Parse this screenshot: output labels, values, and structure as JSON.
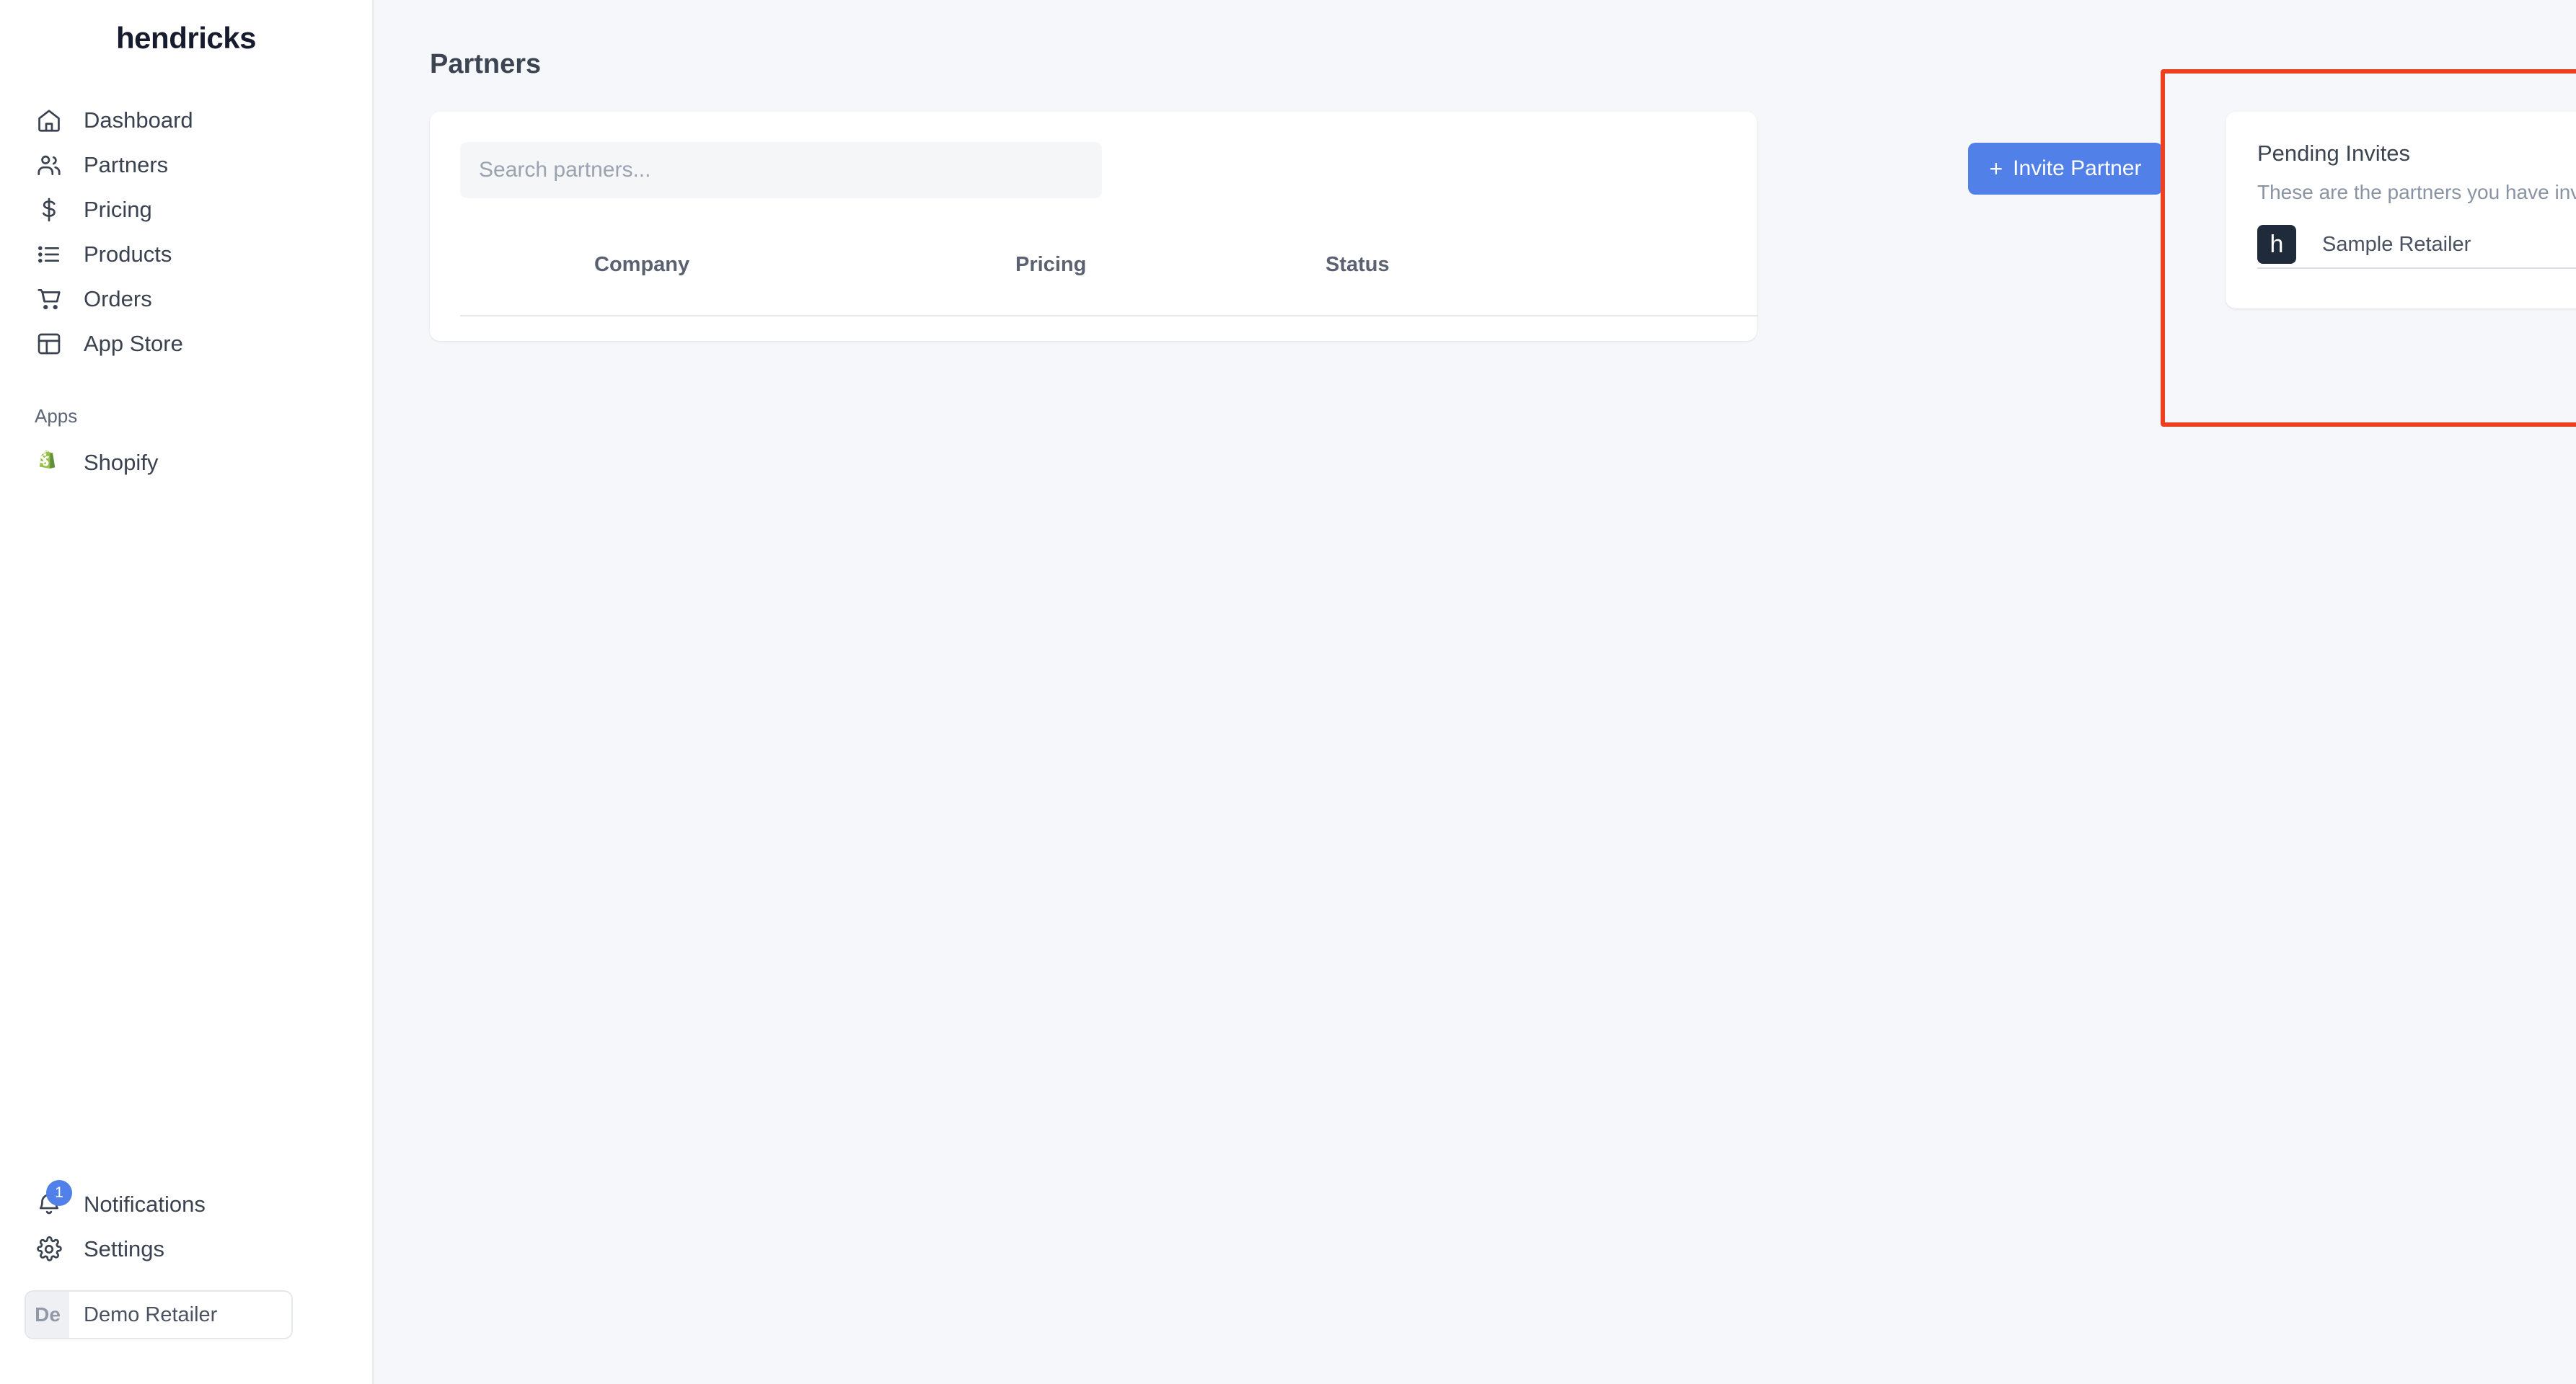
{
  "sidebar": {
    "brand": "hendricks",
    "nav_items": [
      {
        "label": "Dashboard",
        "icon": "home-icon"
      },
      {
        "label": "Partners",
        "icon": "users-icon"
      },
      {
        "label": "Pricing",
        "icon": "dollar-icon"
      },
      {
        "label": "Products",
        "icon": "list-icon"
      },
      {
        "label": "Orders",
        "icon": "cart-icon"
      },
      {
        "label": "App Store",
        "icon": "layout-icon"
      }
    ],
    "apps_section_label": "Apps",
    "apps": [
      {
        "label": "Shopify",
        "icon": "shopify-icon"
      }
    ],
    "bottom_items": [
      {
        "label": "Notifications",
        "icon": "bell-icon",
        "badge": "1"
      },
      {
        "label": "Settings",
        "icon": "gear-icon"
      }
    ],
    "user": {
      "initials": "De",
      "name": "Demo Retailer"
    }
  },
  "main": {
    "page_title": "Partners",
    "search": {
      "placeholder": "Search partners...",
      "value": ""
    },
    "invite_button": {
      "label": "Invite Partner",
      "icon": "plus-icon"
    },
    "table": {
      "columns": [
        "Company",
        "Pricing",
        "Status"
      ],
      "rows": []
    }
  },
  "pending_invites": {
    "title": "Pending Invites",
    "subtitle": "These are the partners you have invited to trade with you.",
    "rows": [
      {
        "logo_letter": "h",
        "company": "Sample Retailer",
        "accept_icon": "check-icon",
        "decline_icon": "close-icon"
      }
    ]
  },
  "colors": {
    "accent_blue": "#5080E8",
    "highlight_red": "#EE4020",
    "accept_green": "#4CAF50",
    "decline_red": "#E0402B",
    "logo_dark": "#1F2A3A",
    "shopify_green": "#95BF47",
    "page_bg": "#F5F7FA"
  }
}
